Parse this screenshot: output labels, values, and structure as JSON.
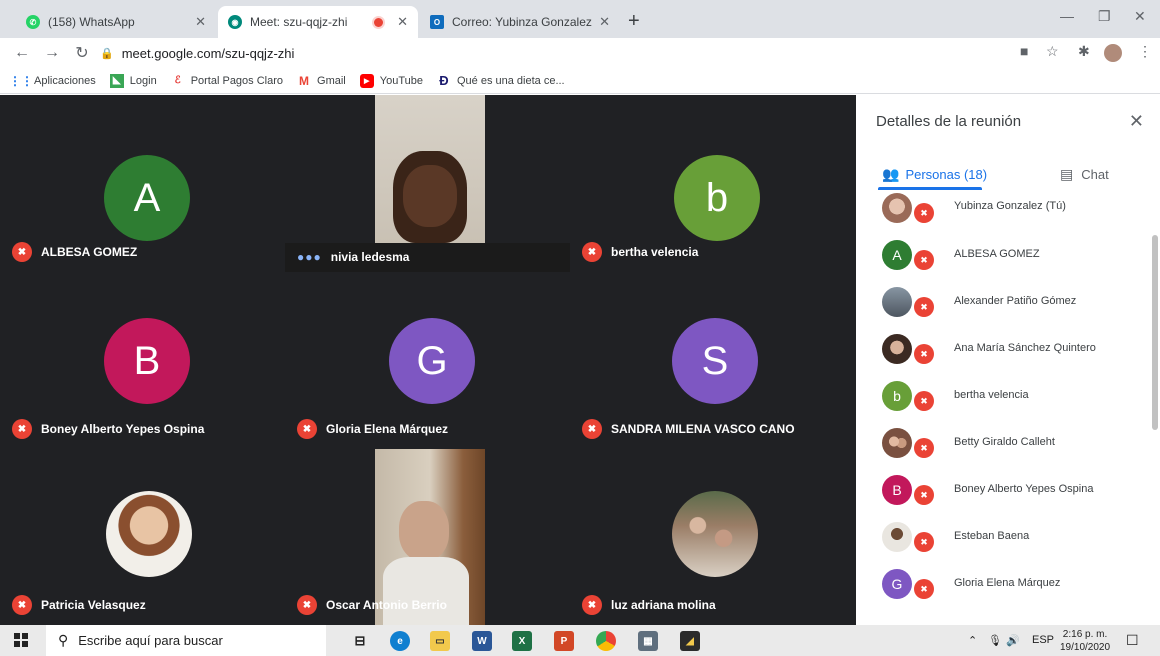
{
  "browser": {
    "tabs": [
      {
        "title": "(158) WhatsApp",
        "fav_color": "#25d366",
        "fav_glyph": "158"
      },
      {
        "title": "Meet: szu-qqjz-zhi",
        "fav_color": "#00897b",
        "fav_glyph": "●"
      },
      {
        "title": "Correo: Yubinza Gonzalez Uribe ·",
        "fav_color": "#0f6cbd",
        "fav_glyph": "O"
      }
    ],
    "url": "meet.google.com/szu-qqjz-zhi",
    "bookmarks": [
      {
        "label": "Aplicaciones",
        "icon": "apps-grid-icon"
      },
      {
        "label": "Login",
        "icon": "login-icon"
      },
      {
        "label": "Portal Pagos Claro",
        "icon": "claro-icon"
      },
      {
        "label": "Gmail",
        "icon": "gmail-icon"
      },
      {
        "label": "YouTube",
        "icon": "youtube-icon"
      },
      {
        "label": "Qué es una dieta ce...",
        "icon": "dieta-icon"
      }
    ]
  },
  "tiles": [
    {
      "name": "ALBESA GOMEZ",
      "kind": "avatar",
      "letter": "A",
      "color": "#2e7d32"
    },
    {
      "name": "nivia ledesma",
      "kind": "video",
      "speaking": true
    },
    {
      "name": "bertha velencia",
      "kind": "avatar",
      "letter": "b",
      "color": "#689f38"
    },
    {
      "name": "Boney Alberto Yepes Ospina",
      "kind": "avatar",
      "letter": "B",
      "color": "#c2185b"
    },
    {
      "name": "Gloria Elena Márquez",
      "kind": "avatar",
      "letter": "G",
      "color": "#7e57c2"
    },
    {
      "name": "SANDRA MILENA VASCO CANO",
      "kind": "avatar",
      "letter": "S",
      "color": "#7e57c2"
    },
    {
      "name": "Patricia Velasquez",
      "kind": "photo"
    },
    {
      "name": "Oscar Antonio Berrio",
      "kind": "video"
    },
    {
      "name": "luz adriana molina",
      "kind": "photo"
    }
  ],
  "panel": {
    "title": "Detalles de la reunión",
    "tab_people": "Personas (18)",
    "tab_chat": "Chat",
    "participants": [
      {
        "name": "Yubinza Gonzalez (Tú)",
        "kind": "photo",
        "color": "#b58a7a"
      },
      {
        "name": "ALBESA GOMEZ",
        "kind": "letter",
        "letter": "A",
        "color": "#2e7d32"
      },
      {
        "name": "Alexander Patiño Gómez",
        "kind": "photo",
        "color": "#6d7b8a"
      },
      {
        "name": "Ana María Sánchez Quintero",
        "kind": "photo",
        "color": "#5d4a3f"
      },
      {
        "name": "bertha velencia",
        "kind": "letter",
        "letter": "b",
        "color": "#689f38"
      },
      {
        "name": "Betty Giraldo Calleht",
        "kind": "photo",
        "color": "#a0745a"
      },
      {
        "name": "Boney Alberto Yepes Ospina",
        "kind": "letter",
        "letter": "B",
        "color": "#c2185b"
      },
      {
        "name": "Esteban Baena",
        "kind": "photo",
        "color": "#7a5c45"
      },
      {
        "name": "Gloria Elena Márquez",
        "kind": "letter",
        "letter": "G",
        "color": "#7e57c2"
      }
    ]
  },
  "taskbar": {
    "search_placeholder": "Escribe aquí para buscar",
    "lang": "ESP",
    "time": "2:16 p. m.",
    "date": "19/10/2020"
  }
}
